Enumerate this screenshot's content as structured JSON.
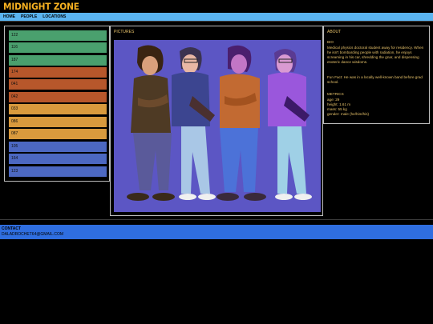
{
  "site": {
    "title": "MIDNIGHT ZONE"
  },
  "nav": {
    "items": [
      "HOME",
      "PEOPLE",
      "LOCATIONS"
    ]
  },
  "list": {
    "items": [
      {
        "label": "122",
        "color": "#4aa06e"
      },
      {
        "label": "116",
        "color": "#4aa06e"
      },
      {
        "label": "187",
        "color": "#4aa06e"
      },
      {
        "label": "174",
        "color": "#b7572b"
      },
      {
        "label": "041",
        "color": "#b7572b"
      },
      {
        "label": "042",
        "color": "#b7572b"
      },
      {
        "label": "033",
        "color": "#d99a3d"
      },
      {
        "label": "086",
        "color": "#d99a3d"
      },
      {
        "label": "087",
        "color": "#d99a3d"
      },
      {
        "label": "105",
        "color": "#4c68c2"
      },
      {
        "label": "164",
        "color": "#4c68c2"
      },
      {
        "label": "123",
        "color": "#4c68c2"
      }
    ]
  },
  "pictures": {
    "label": "PICTURES"
  },
  "about": {
    "label": "ABOUT",
    "bio_title": "BIO",
    "bio": "Medical physics doctoral student away for residency. When he isn't bombarding people with radiation, he enjoys screaming in his car, shredding the gnar, and dispensing esoteric dance wisdoms.",
    "fun_fact": "Fun Fact: He was in a locally well-known band before grad school.",
    "metrics_title": "METRICS",
    "metrics": [
      "age: 29",
      "height: 1.61 m",
      "mass: 55 kg",
      "gender: male (he/him/his)"
    ]
  },
  "footer": {
    "title": "CONTACT",
    "email": "DALADROCHET64@GMAIL.COM"
  },
  "colors": {
    "accent": "#f5b021",
    "nav": "#5ab4f0",
    "footer": "#2f6ee0",
    "art_bg": "#5c56c4"
  }
}
